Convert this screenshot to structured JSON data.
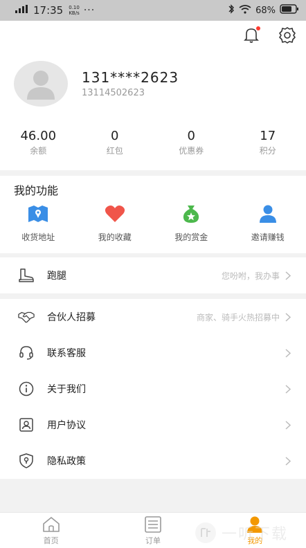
{
  "status_bar": {
    "network": "4G",
    "time": "17:35",
    "speed_value": "0.10",
    "speed_unit": "KB/s",
    "dots": "···",
    "battery": "68%"
  },
  "profile": {
    "phone_masked": "131****2623",
    "phone_full": "13114502623"
  },
  "stats": [
    {
      "value": "46.00",
      "label": "余额"
    },
    {
      "value": "0",
      "label": "红包"
    },
    {
      "value": "0",
      "label": "优惠券"
    },
    {
      "value": "17",
      "label": "积分"
    }
  ],
  "functions": {
    "title": "我的功能",
    "items": [
      {
        "label": "收货地址",
        "icon": "map-icon",
        "color": "#3a8ee6"
      },
      {
        "label": "我的收藏",
        "icon": "heart-icon",
        "color": "#f0554a"
      },
      {
        "label": "我的赏金",
        "icon": "money-bag-icon",
        "color": "#4cb84c"
      },
      {
        "label": "邀请赚钱",
        "icon": "person-icon",
        "color": "#3a8ee6"
      }
    ]
  },
  "menu": {
    "errand": {
      "label": "跑腿",
      "hint": "您吩咐，我办事"
    },
    "items": [
      {
        "label": "合伙人招募",
        "hint": "商家、骑手火热招募中"
      },
      {
        "label": "联系客服",
        "hint": ""
      },
      {
        "label": "关于我们",
        "hint": ""
      },
      {
        "label": "用户协议",
        "hint": ""
      },
      {
        "label": "隐私政策",
        "hint": ""
      }
    ]
  },
  "tabs": [
    {
      "label": "首页",
      "icon": "home-icon"
    },
    {
      "label": "订单",
      "icon": "order-icon"
    },
    {
      "label": "我的",
      "icon": "mine-icon",
      "active": true
    }
  ],
  "watermark": {
    "text": "一听下载"
  },
  "colors": {
    "accent": "#f39800",
    "blue": "#3a8ee6",
    "red": "#f0554a",
    "green": "#4cb84c"
  }
}
